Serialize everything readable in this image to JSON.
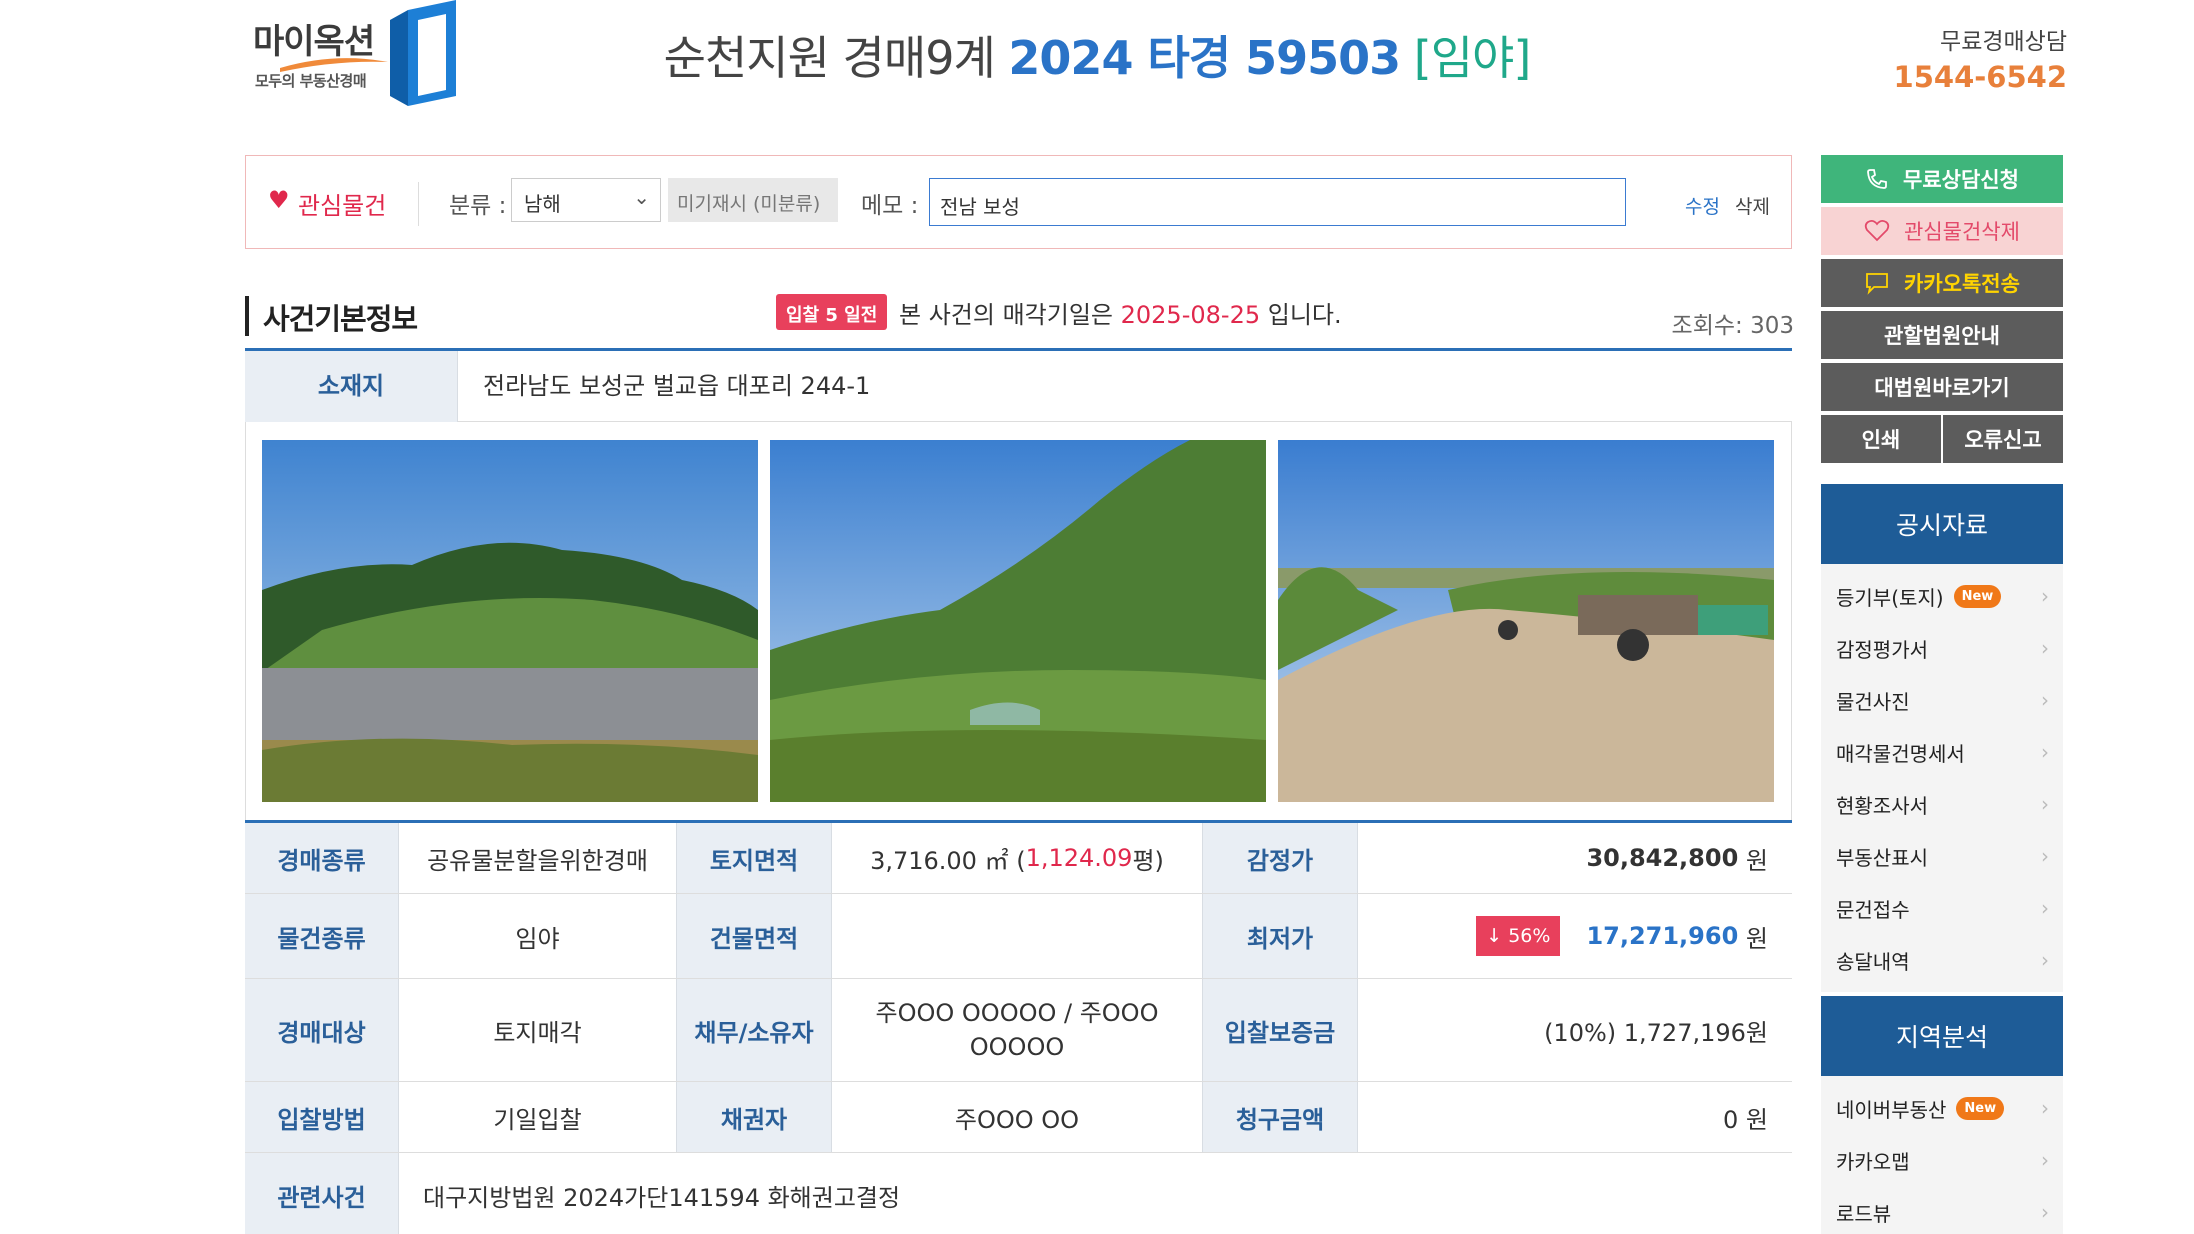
{
  "logo": {
    "main": "마이옥션",
    "sub": "모두의 부동산경매"
  },
  "header": {
    "court": "순천지원 경매9계",
    "case_no": "2024 타경 59503",
    "type": "[임야]",
    "consult_label": "무료경매상담",
    "consult_phone": "1544-6542"
  },
  "interest": {
    "label": "관심물건",
    "category_label": "분류 :",
    "category_value": "남해",
    "unclassified": "미기재시 (미분류)",
    "memo_label": "메모 :",
    "memo_value": "전남 보성",
    "edit": "수정",
    "delete": "삭제"
  },
  "section": {
    "title": "사건기본정보",
    "badge": "입찰 5 일전",
    "bid_prefix": "본 사건의 매각기일은",
    "bid_date": "2025-08-25",
    "bid_suffix": "입니다.",
    "views": "조회수: 303"
  },
  "location": {
    "label": "소재지",
    "value": "전라남도 보성군 벌교읍 대포리 244-1"
  },
  "info": {
    "r1": {
      "h1": "경매종류",
      "v1": "공유물분할을위한경매",
      "h2": "토지면적",
      "v2a": "3,716.00 ㎡ (",
      "v2b": "1,124.09",
      "v2c": "평)",
      "h3": "감정가",
      "v3": "30,842,800",
      "unit": "원"
    },
    "r2": {
      "h1": "물건종류",
      "v1": "임야",
      "h2": "건물면적",
      "v2": "",
      "h3": "최저가",
      "badge": "↓ 56%",
      "v3": "17,271,960",
      "unit": "원"
    },
    "r3": {
      "h1": "경매대상",
      "v1": "토지매각",
      "h2": "채무/소유자",
      "v2": "주OOO OOOOO / 주OOO OOOOO",
      "h3": "입찰보증금",
      "v3": "(10%) 1,727,196원"
    },
    "r4": {
      "h1": "입찰방법",
      "v1": "기일입찰",
      "h2": "채권자",
      "v2": "주OOO OO",
      "h3": "청구금액",
      "v3": "0 원"
    },
    "r5": {
      "h1": "관련사건",
      "v1": "대구지방법원 2024가단141594 화해권고결정"
    }
  },
  "sidebar": {
    "consult": "무료상담신청",
    "remove_interest": "관심물건삭제",
    "kakao": "카카오톡전송",
    "court_info": "관할법원안내",
    "supreme_court": "대법원바로가기",
    "print": "인쇄",
    "report": "오류신고",
    "public_title": "공시자료",
    "public_items": [
      "등기부(토지)",
      "감정평가서",
      "물건사진",
      "매각물건명세서",
      "현황조사서",
      "부동산표시",
      "문건접수",
      "송달내역"
    ],
    "new_badge": "New",
    "region_title": "지역분석",
    "region_items": [
      "네이버부동산",
      "카카오맵",
      "로드뷰"
    ]
  },
  "colors": {
    "accent_blue": "#2a73c7",
    "accent_red": "#e0284c",
    "header_navy": "#1e5c97",
    "green": "#3fb57b"
  }
}
